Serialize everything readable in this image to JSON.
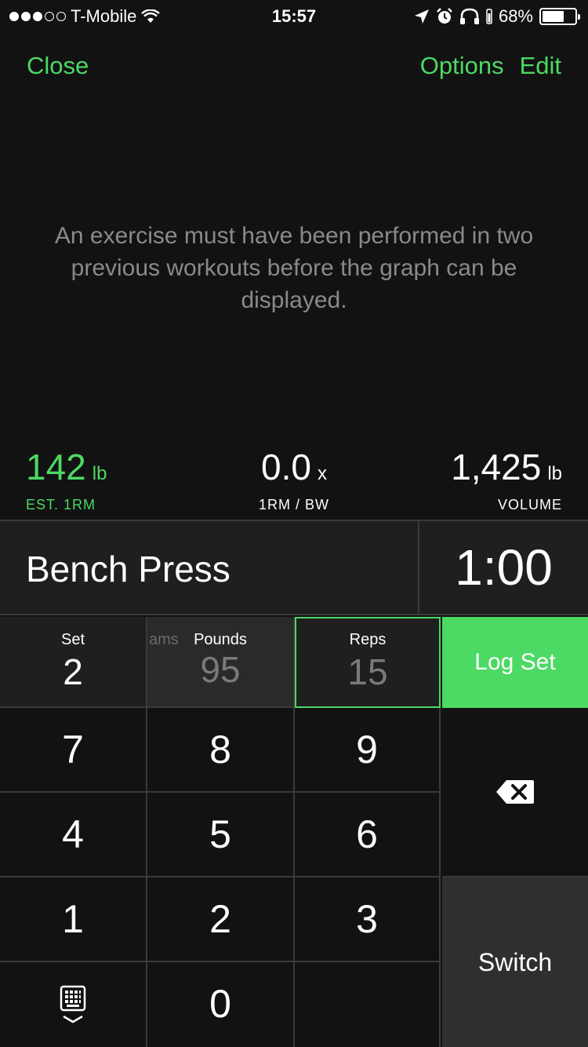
{
  "status_bar": {
    "carrier": "T-Mobile",
    "time": "15:57",
    "battery": "68%",
    "battery_level": 0.68
  },
  "nav": {
    "close": "Close",
    "options": "Options",
    "edit": "Edit"
  },
  "message": "An exercise must have been performed in two previous workouts before the graph can be displayed.",
  "stats": {
    "est_1rm": {
      "value": "142",
      "unit": "lb",
      "label": "EST. 1RM"
    },
    "ratio": {
      "value": "0.0",
      "unit": "x",
      "label": "1RM / BW"
    },
    "volume": {
      "value": "1,425",
      "unit": "lb",
      "label": "VOLUME"
    }
  },
  "exercise": {
    "name": "Bench Press",
    "timer": "1:00"
  },
  "fields": {
    "set": {
      "label": "Set",
      "value": "2"
    },
    "pounds": {
      "ghost_label": "ams",
      "label": "Pounds",
      "value": "95"
    },
    "reps": {
      "label": "Reps",
      "value": "15"
    }
  },
  "log_set": "Log Set",
  "keypad": {
    "k7": "7",
    "k8": "8",
    "k9": "9",
    "k4": "4",
    "k5": "5",
    "k6": "6",
    "k1": "1",
    "k2": "2",
    "k3": "3",
    "k0": "0",
    "switch": "Switch"
  },
  "colors": {
    "accent": "#4cd964",
    "background": "#121212",
    "cell": "#1f1f1f",
    "divider": "#3a3a3a"
  }
}
